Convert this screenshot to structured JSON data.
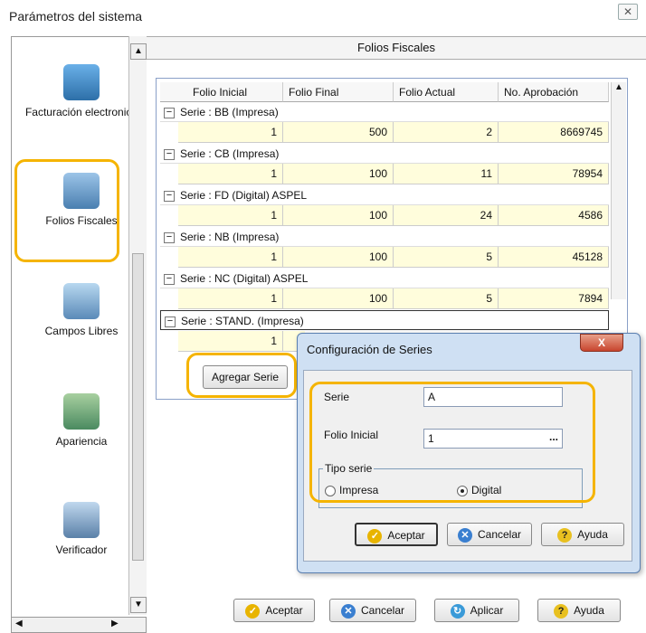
{
  "window": {
    "title": "Parámetros del sistema",
    "close_glyph": "✕"
  },
  "sidebar": {
    "items": [
      {
        "label": "Facturación electronica",
        "icon": "invoice-monitor-icon"
      },
      {
        "label": "Folios Fiscales",
        "icon": "folios-icon"
      },
      {
        "label": "Campos Libres",
        "icon": "fields-icon"
      },
      {
        "label": "Apariencia",
        "icon": "appearance-icon"
      },
      {
        "label": "Verificador",
        "icon": "verifier-icon"
      }
    ]
  },
  "header": {
    "title": "Folios Fiscales"
  },
  "grid": {
    "columns": [
      "Folio Inicial",
      "Folio Final",
      "Folio Actual",
      "No. Aprobación"
    ],
    "groups": [
      {
        "label": "Serie : BB (Impresa)",
        "row": [
          "1",
          "500",
          "2",
          "8669745"
        ]
      },
      {
        "label": "Serie : CB (Impresa)",
        "row": [
          "1",
          "100",
          "11",
          "78954"
        ]
      },
      {
        "label": "Serie : FD (Digital) ASPEL",
        "row": [
          "1",
          "100",
          "24",
          "4586"
        ]
      },
      {
        "label": "Serie : NB (Impresa)",
        "row": [
          "1",
          "100",
          "5",
          "45128"
        ]
      },
      {
        "label": "Serie : NC (Digital) ASPEL",
        "row": [
          "1",
          "100",
          "5",
          "7894"
        ]
      },
      {
        "label": "Serie : STAND. (Impresa)",
        "row": [
          "1",
          "",
          "",
          ""
        ]
      }
    ],
    "toggle_glyph": "−",
    "add_series_button": "Agregar Serie"
  },
  "footer": {
    "accept": "Aceptar",
    "cancel": "Cancelar",
    "apply": "Aplicar",
    "help": "Ayuda"
  },
  "dialog": {
    "title": "Configuración de Series",
    "close_glyph": "X",
    "serie_label": "Serie",
    "serie_value": "A",
    "folio_label": "Folio Inicial",
    "folio_value": "1",
    "folio_button": "...",
    "tipo_label": "Tipo serie",
    "option_impresa": "Impresa",
    "option_digital": "Digital",
    "selected": "Digital",
    "accept": "Aceptar",
    "cancel": "Cancelar",
    "help": "Ayuda"
  },
  "colors": {
    "highlight": "#f5b400",
    "row_bg": "#fffddc",
    "dialog_bg": "#cfe0f3"
  }
}
